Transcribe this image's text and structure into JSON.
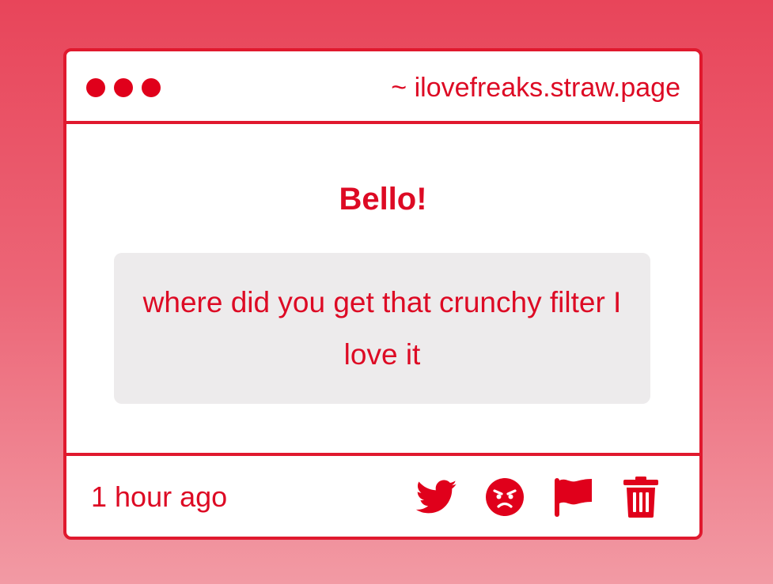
{
  "window": {
    "url": "~ ilovefreaks.straw.page"
  },
  "message": {
    "greeting": "Bello!",
    "body": "where did you get that crunchy filter I love it"
  },
  "footer": {
    "timestamp": "1 hour ago",
    "actions": [
      {
        "icon": "twitter-icon"
      },
      {
        "icon": "angry-face-icon"
      },
      {
        "icon": "flag-icon"
      },
      {
        "icon": "trash-icon"
      }
    ]
  },
  "colors": {
    "accent": "#e0001b",
    "text": "#dd0a24",
    "message_background": "#edebec",
    "page_gradient_top": "#e8455a",
    "page_gradient_bottom": "#f29aa4"
  }
}
